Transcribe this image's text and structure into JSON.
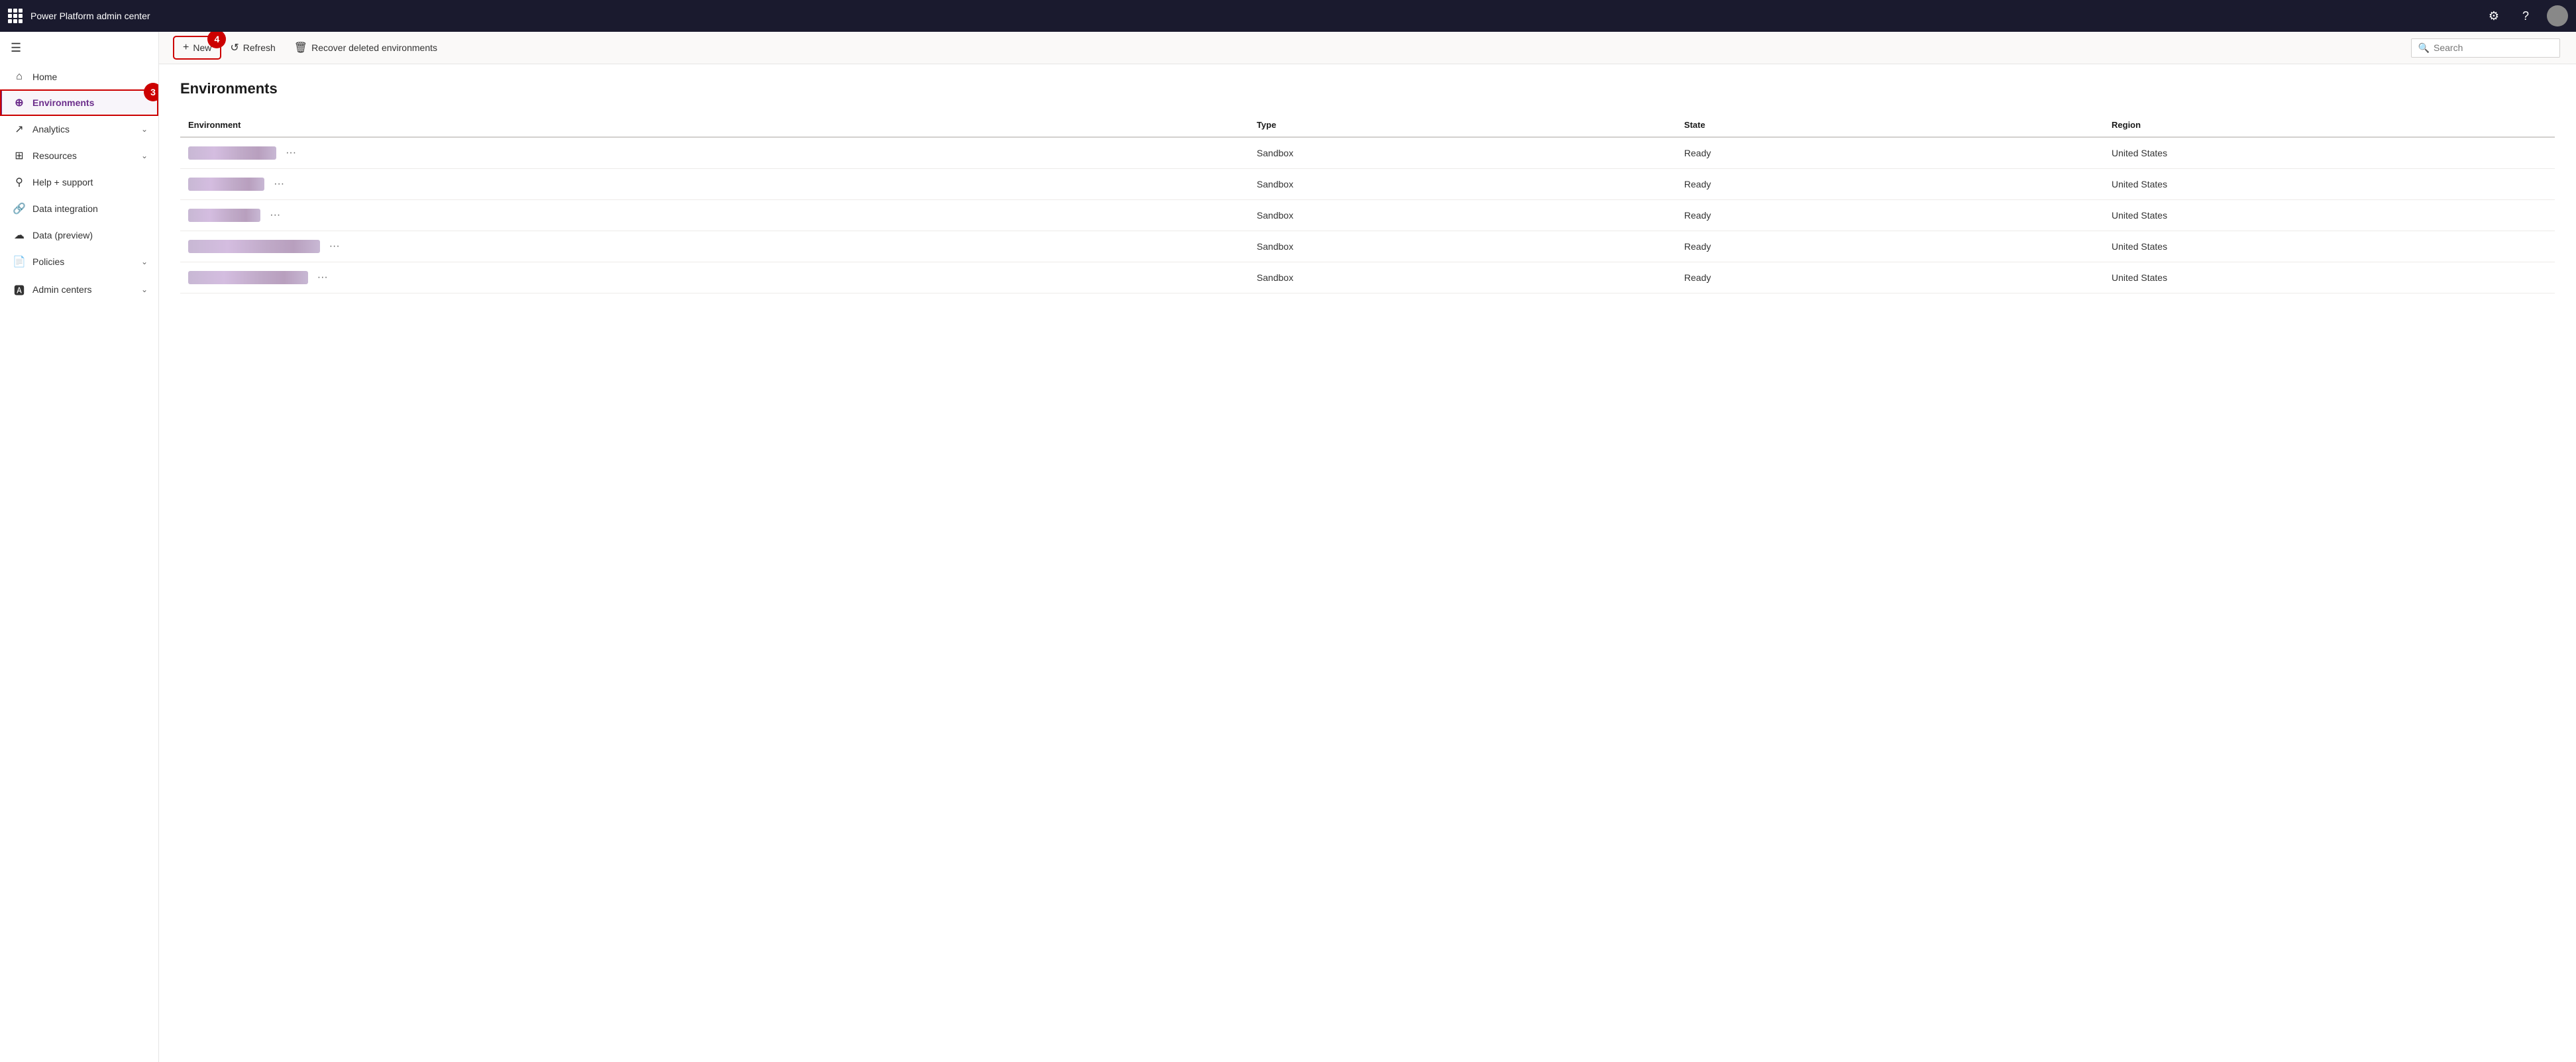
{
  "topbar": {
    "title": "Power Platform admin center",
    "settings_icon": "⚙",
    "help_icon": "?",
    "waffle_icon": true
  },
  "sidebar": {
    "menu_icon": "☰",
    "items": [
      {
        "id": "home",
        "label": "Home",
        "icon": "🏠",
        "has_chevron": false,
        "active": false
      },
      {
        "id": "environments",
        "label": "Environments",
        "icon": "🌐",
        "has_chevron": false,
        "active": true,
        "annotation": "3"
      },
      {
        "id": "analytics",
        "label": "Analytics",
        "icon": "📈",
        "has_chevron": true,
        "active": false
      },
      {
        "id": "resources",
        "label": "Resources",
        "icon": "📋",
        "has_chevron": true,
        "active": false
      },
      {
        "id": "help-support",
        "label": "Help + support",
        "icon": "🎧",
        "has_chevron": false,
        "active": false
      },
      {
        "id": "data-integration",
        "label": "Data integration",
        "icon": "🔗",
        "has_chevron": false,
        "active": false
      },
      {
        "id": "data-preview",
        "label": "Data (preview)",
        "icon": "☁",
        "has_chevron": false,
        "active": false
      },
      {
        "id": "policies",
        "label": "Policies",
        "icon": "📄",
        "has_chevron": true,
        "active": false
      },
      {
        "id": "admin-centers",
        "label": "Admin centers",
        "icon": "🅰",
        "has_chevron": true,
        "active": false
      }
    ]
  },
  "toolbar": {
    "new_label": "New",
    "new_icon": "+",
    "refresh_label": "Refresh",
    "refresh_icon": "↺",
    "recover_label": "Recover deleted environments",
    "recover_icon": "🗑",
    "search_placeholder": "Search",
    "search_icon": "🔍",
    "new_annotation": "4"
  },
  "page": {
    "title": "Environments",
    "table": {
      "columns": [
        "Environment",
        "Type",
        "State",
        "Region"
      ],
      "rows": [
        {
          "name": "██████ ████",
          "type": "Sandbox",
          "state": "Ready",
          "region": "United States"
        },
        {
          "name": "████ ██ ██",
          "type": "Sandbox",
          "state": "Ready",
          "region": "United States"
        },
        {
          "name": "████ ████",
          "type": "Sandbox",
          "state": "Ready",
          "region": "United States"
        },
        {
          "name": "████████████████",
          "type": "Sandbox",
          "state": "Ready",
          "region": "United States"
        },
        {
          "name": "████ ██████████",
          "type": "Sandbox",
          "state": "Ready",
          "region": "United States"
        }
      ]
    }
  }
}
